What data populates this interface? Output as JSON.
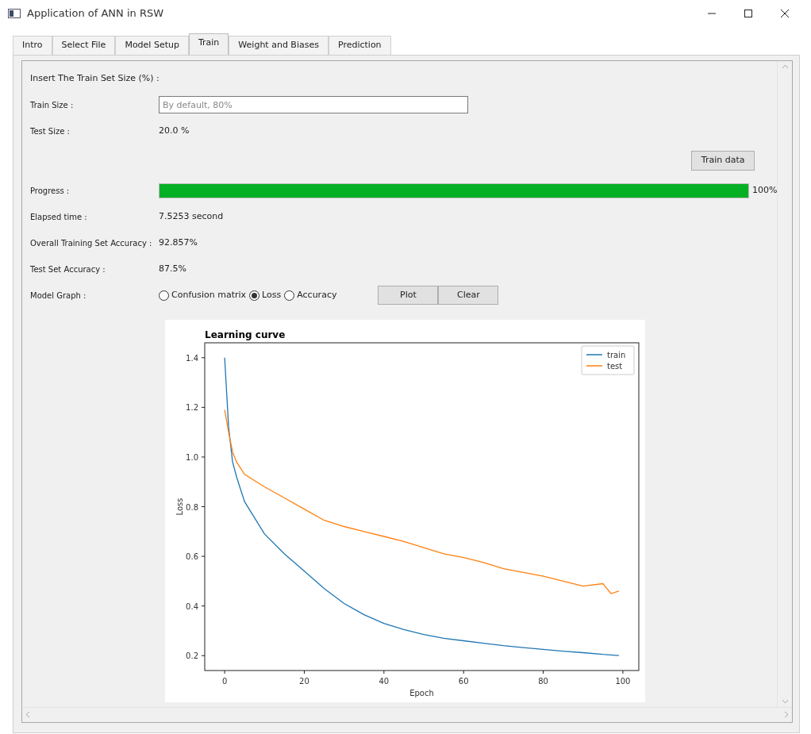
{
  "window": {
    "title": "Application of ANN in RSW"
  },
  "tabs": [
    {
      "label": "Intro",
      "selected": false
    },
    {
      "label": "Select File",
      "selected": false
    },
    {
      "label": "Model Setup",
      "selected": false
    },
    {
      "label": "Train",
      "selected": true
    },
    {
      "label": "Weight and Biases",
      "selected": false
    },
    {
      "label": "Prediction",
      "selected": false
    }
  ],
  "train": {
    "heading": "Insert The Train Set Size (%) :",
    "train_size": {
      "label": "Train Size :",
      "placeholder": "By default, 80%"
    },
    "test_size": {
      "label": "Test Size :",
      "value": "20.0 %"
    },
    "train_button": "Train data",
    "progress": {
      "label": "Progress :",
      "level": 1,
      "reading": "100%"
    },
    "results": [
      {
        "label": "Elapsed time :",
        "value": "7.5253 second"
      },
      {
        "label": "Overall Training Set Accuracy :",
        "value": "92.857%"
      },
      {
        "label": "Test Set Accuracy :",
        "value": "87.5%"
      }
    ],
    "model_graph": {
      "label": "Model Graph :",
      "options": [
        {
          "label": "Confusion matrix",
          "selected": false
        },
        {
          "label": "Loss",
          "selected": true
        },
        {
          "label": "Accuracy",
          "selected": false
        }
      ],
      "buttons": [
        "Plot",
        "Clear"
      ]
    },
    "chart_data": {
      "type": "line",
      "title": "Learning curve",
      "xlabel": "Epoch",
      "ylabel": "Loss",
      "x": [
        0,
        1,
        2,
        3,
        5,
        10,
        15,
        20,
        25,
        30,
        35,
        40,
        45,
        50,
        55,
        60,
        65,
        70,
        75,
        80,
        85,
        90,
        95,
        97,
        99
      ],
      "series": [
        {
          "name": "train",
          "color": "#1f77b4",
          "values": [
            1.4,
            1.12,
            0.98,
            0.92,
            0.82,
            0.69,
            0.61,
            0.54,
            0.47,
            0.41,
            0.365,
            0.33,
            0.305,
            0.285,
            0.27,
            0.26,
            0.25,
            0.24,
            0.232,
            0.225,
            0.218,
            0.212,
            0.205,
            0.203,
            0.2
          ]
        },
        {
          "name": "test",
          "color": "#ff7f0e",
          "values": [
            1.19,
            1.1,
            1.02,
            0.98,
            0.93,
            0.88,
            0.835,
            0.79,
            0.745,
            0.72,
            0.7,
            0.68,
            0.66,
            0.635,
            0.61,
            0.595,
            0.575,
            0.55,
            0.535,
            0.52,
            0.5,
            0.48,
            0.49,
            0.45,
            0.46
          ]
        }
      ],
      "xlim": [
        -5,
        104
      ],
      "ylim": [
        0.14,
        1.46
      ],
      "xticks": [
        0,
        20,
        40,
        60,
        80,
        100
      ],
      "yticks": [
        0.2,
        0.4,
        0.6,
        0.8,
        {
          "value": 1,
          "label": "1.0"
        },
        1.2,
        1.4
      ],
      "legend": "upper right"
    }
  }
}
